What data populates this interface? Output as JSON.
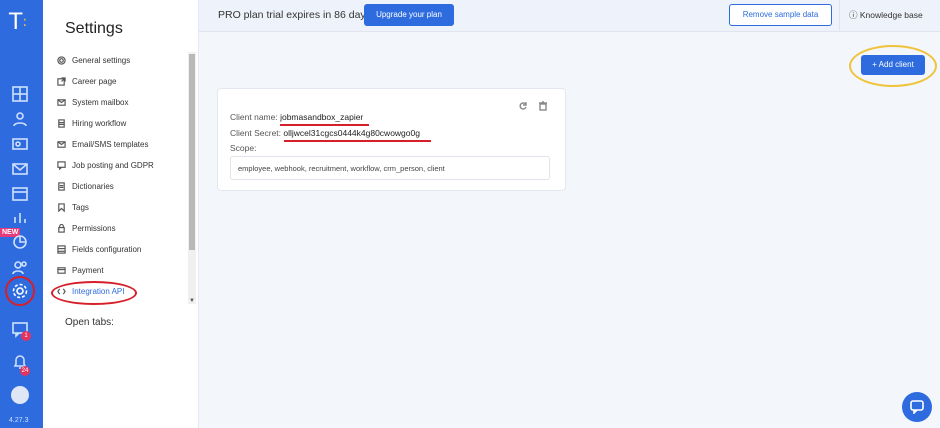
{
  "app": {
    "logo": "T",
    "version": "4.27.3",
    "new_badge": "NEW",
    "chat_badge_count": "1",
    "notifications_count": "24"
  },
  "settings": {
    "title": "Settings",
    "items": [
      {
        "label": "General settings",
        "icon": "gear-icon"
      },
      {
        "label": "Career page",
        "icon": "external-link-icon"
      },
      {
        "label": "System mailbox",
        "icon": "mail-icon"
      },
      {
        "label": "Hiring workflow",
        "icon": "stack-icon"
      },
      {
        "label": "Email/SMS templates",
        "icon": "envelope-icon"
      },
      {
        "label": "Job posting and GDPR",
        "icon": "chat-icon"
      },
      {
        "label": "Dictionaries",
        "icon": "list-icon"
      },
      {
        "label": "Tags",
        "icon": "bookmark-icon"
      },
      {
        "label": "Permissions",
        "icon": "lock-icon"
      },
      {
        "label": "Fields configuration",
        "icon": "fields-icon"
      },
      {
        "label": "Payment",
        "icon": "card-icon"
      },
      {
        "label": "Integration API",
        "icon": "api-icon"
      }
    ],
    "open_tabs": "Open tabs:"
  },
  "topbar": {
    "trial_text": "PRO plan trial expires in 86 days",
    "upgrade_label": "Upgrade your plan",
    "remove_sample_label": "Remove sample data",
    "knowledge_base_label": "Knowledge base"
  },
  "main": {
    "add_client_label": "+ Add client",
    "client": {
      "name_label": "Client name:",
      "name_value": "jobmasandbox_zapier",
      "secret_label": "Client Secret:",
      "secret_value": "olljwcel31cgcs0444k4g80cwowgo0g",
      "scope_label": "Scope:",
      "scope_value": "employee, webhook, recruitment, workflow, crm_person, client"
    }
  },
  "colors": {
    "accent": "#2d6bdf",
    "annotation_red": "#d61f2a",
    "annotation_yellow": "#f0c33c"
  }
}
